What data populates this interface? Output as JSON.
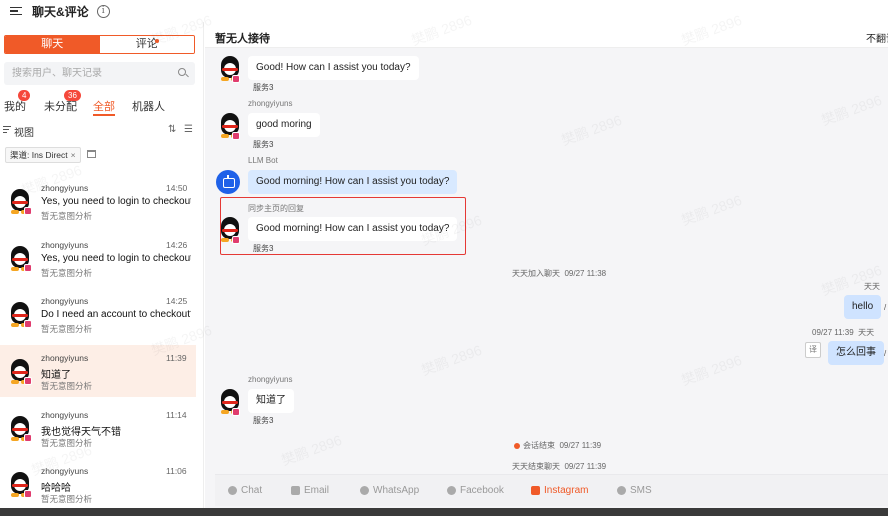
{
  "app": {
    "title": "聊天&评论"
  },
  "left": {
    "segments": [
      {
        "label": "聊天"
      },
      {
        "label": "评论"
      }
    ],
    "search_placeholder": "搜索用户、聊天记录",
    "tabs": [
      {
        "label": "我的",
        "badge": "4"
      },
      {
        "label": "未分配",
        "badge": "36"
      },
      {
        "label": "全部",
        "badge": ""
      },
      {
        "label": "机器人",
        "badge": ""
      }
    ],
    "view_label": "视图",
    "filter_chip": {
      "label": "渠道: Ins Direct",
      "close": "×"
    },
    "conversations": [
      {
        "name": "zhongyiyuns",
        "time": "14:50",
        "message": "Yes, you need to login to checkout",
        "sub": "暂无意图分析"
      },
      {
        "name": "zhongyiyuns",
        "time": "14:26",
        "message": "Yes, you need to login to checkout",
        "sub": "暂无意图分析"
      },
      {
        "name": "zhongyiyuns",
        "time": "14:25",
        "message": "Do I need an account to checkout?",
        "sub": "暂无意图分析"
      },
      {
        "name": "zhongyiyuns",
        "time": "11:39",
        "message": "知道了",
        "sub": "暂无意图分析"
      },
      {
        "name": "zhongyiyuns",
        "time": "11:14",
        "message": "我也觉得天气不错",
        "sub": "暂无意图分析"
      },
      {
        "name": "zhongyiyuns",
        "time": "11:06",
        "message": "哈哈哈",
        "sub": "暂无意图分析"
      }
    ]
  },
  "chat": {
    "title": "暂无人接待",
    "right_label": "不翻译",
    "messages": {
      "m1": {
        "text": "Good! How can I assist you today?",
        "agent": "服务3"
      },
      "m2": {
        "sender": "zhongyiyuns",
        "text": "good moring",
        "agent": "服务3"
      },
      "m3": {
        "sender": "LLM Bot",
        "text": "Good morning! How can I assist you today?"
      },
      "m4": {
        "sender": "同步主页的回复",
        "text": "Good morning! How can I assist you today?",
        "agent": "服务3"
      },
      "sys1": {
        "text": "天天加入聊天",
        "time": "09/27 11:38"
      },
      "me1": {
        "sender": "天天",
        "text": "hello"
      },
      "me2": {
        "time": "09/27 11:39",
        "sender": "天天",
        "text": "怎么回事",
        "translate": "译"
      },
      "m5": {
        "sender": "zhongyiyuns",
        "text": "知道了",
        "agent": "服务3"
      },
      "sys2": {
        "text": "会话结束",
        "time": "09/27 11:39"
      },
      "sys3": {
        "text": "天天结束聊天",
        "time": "09/27 11:39"
      }
    },
    "channels": [
      {
        "label": "Chat",
        "active": false
      },
      {
        "label": "Email",
        "active": false
      },
      {
        "label": "WhatsApp",
        "active": false
      },
      {
        "label": "Facebook",
        "active": false
      },
      {
        "label": "Instagram",
        "active": true
      },
      {
        "label": "SMS",
        "active": false
      }
    ]
  },
  "watermark": "樊鹏 2896",
  "colors": {
    "accent": "#f05a28",
    "bot_bubble": "#d8e9ff",
    "badge": "#f5483b",
    "highlight_border": "#e53935"
  }
}
